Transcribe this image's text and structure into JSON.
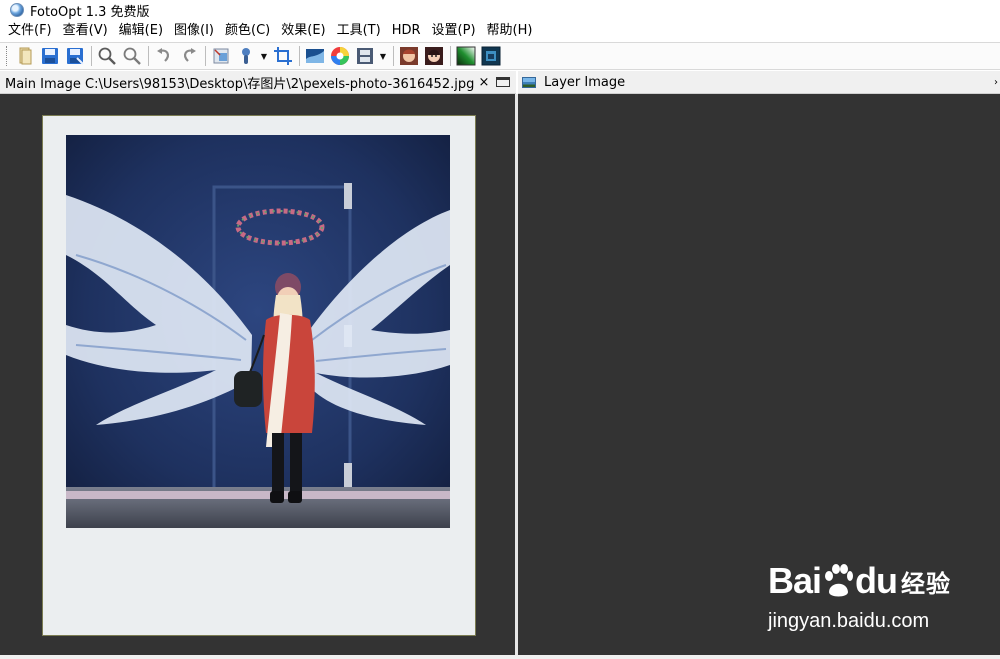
{
  "window": {
    "title": "FotoOpt 1.3 免费版"
  },
  "menu": [
    "文件(F)",
    "查看(V)",
    "编辑(E)",
    "图像(I)",
    "颜色(C)",
    "效果(E)",
    "工具(T)",
    "HDR",
    "设置(P)",
    "帮助(H)"
  ],
  "toolbar": {
    "buttons": [
      {
        "name": "open-icon"
      },
      {
        "name": "save-icon"
      },
      {
        "name": "save-as-icon"
      },
      {
        "name": "zoom-in-icon"
      },
      {
        "name": "zoom-out-icon"
      },
      {
        "name": "undo-icon"
      },
      {
        "name": "redo-icon"
      },
      {
        "name": "resize-icon"
      },
      {
        "name": "clone-brush-icon"
      },
      {
        "name": "crop-icon"
      },
      {
        "name": "levels-icon"
      },
      {
        "name": "color-wheel-icon"
      },
      {
        "name": "filmstrip-icon"
      },
      {
        "name": "face-retouch-icon"
      },
      {
        "name": "portrait-icon"
      },
      {
        "name": "gradient-icon"
      },
      {
        "name": "hdr-image-icon"
      }
    ]
  },
  "main_panel": {
    "title": "Main Image C:\\Users\\98153\\Desktop\\存图片\\2\\pexels-photo-3616452.jpg",
    "close_label": "×"
  },
  "layer_panel": {
    "title": "Layer Image",
    "scroll_arrow": "›"
  },
  "watermark": {
    "logo_left": "Bai",
    "logo_right": "du",
    "logo_cn": "经验",
    "url": "jingyan.baidu.com"
  },
  "colors": {
    "panel_bg": "#333333",
    "polaroid_frame": "#ebeef0",
    "wall_blue": "#1d2c55",
    "coat_red": "#c9453b",
    "wings_white": "#e8eef7"
  }
}
